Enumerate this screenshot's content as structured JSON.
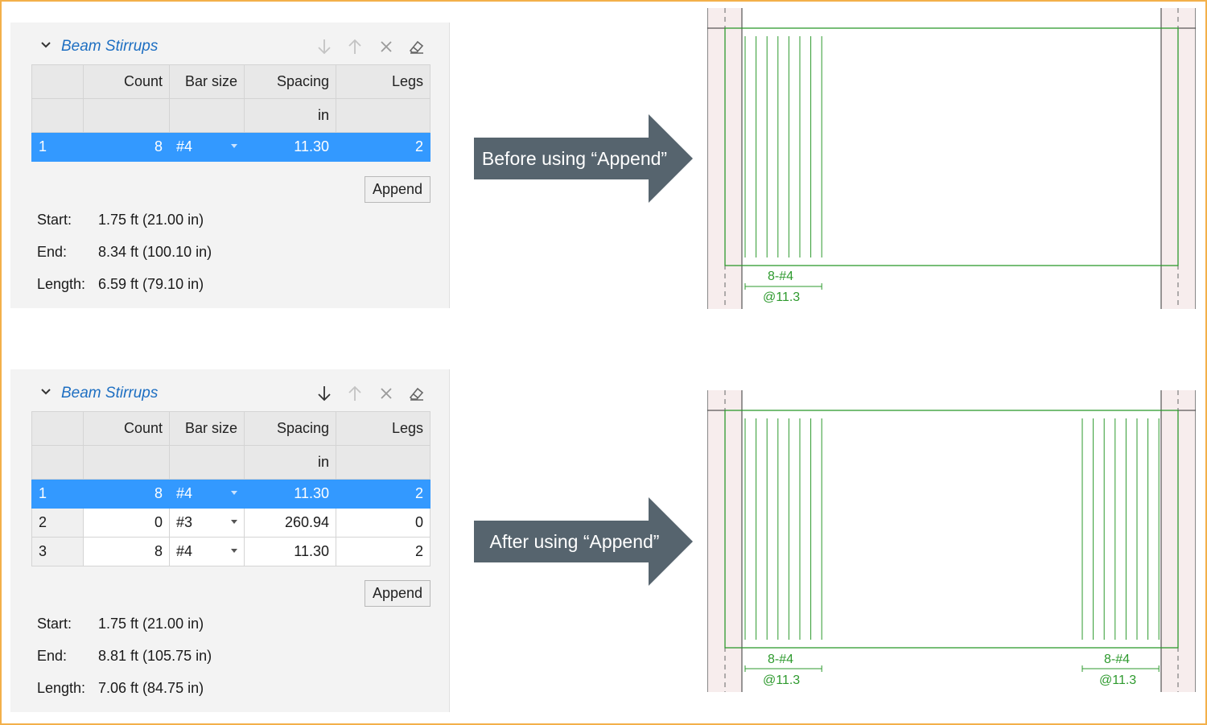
{
  "panels": [
    {
      "title": "Beam Stirrups",
      "icons": [
        "collapse-chevron-icon",
        "move-down-icon",
        "move-up-icon",
        "delete-icon",
        "eraser-icon"
      ],
      "columns": [
        "",
        "Count",
        "Bar size",
        "Spacing",
        "Legs"
      ],
      "units": [
        "",
        "",
        "",
        "in",
        ""
      ],
      "rows": [
        {
          "index": "1",
          "count": "8",
          "bar_size": "#4",
          "spacing": "11.30",
          "legs": "2",
          "selected": true
        }
      ],
      "append_label": "Append",
      "info": [
        {
          "label": "Start:",
          "value": "1.75 ft (21.00 in)"
        },
        {
          "label": "End:",
          "value": "8.34 ft (100.10 in)"
        },
        {
          "label": "Length:",
          "value": "6.59 ft (79.10 in)"
        }
      ]
    },
    {
      "title": "Beam Stirrups",
      "icons": [
        "collapse-chevron-icon",
        "move-down-icon",
        "move-up-icon",
        "delete-icon",
        "eraser-icon"
      ],
      "columns": [
        "",
        "Count",
        "Bar size",
        "Spacing",
        "Legs"
      ],
      "units": [
        "",
        "",
        "",
        "in",
        ""
      ],
      "rows": [
        {
          "index": "1",
          "count": "8",
          "bar_size": "#4",
          "spacing": "11.30",
          "legs": "2",
          "selected": true
        },
        {
          "index": "2",
          "count": "0",
          "bar_size": "#3",
          "spacing": "260.94",
          "legs": "0",
          "selected": false
        },
        {
          "index": "3",
          "count": "8",
          "bar_size": "#4",
          "spacing": "11.30",
          "legs": "2",
          "selected": false
        }
      ],
      "append_label": "Append",
      "info": [
        {
          "label": "Start:",
          "value": "1.75 ft (21.00 in)"
        },
        {
          "label": "End:",
          "value": "8.81 ft (105.75 in)"
        },
        {
          "label": "Length:",
          "value": "7.06 ft (84.75 in)"
        }
      ]
    }
  ],
  "callouts": [
    {
      "text": "Before using “Append”"
    },
    {
      "text": "After using “Append”"
    }
  ],
  "drawings": [
    {
      "groups": [
        {
          "label": "8-#4",
          "spacing_label": "@11.3",
          "side": "left",
          "count": 8
        }
      ]
    },
    {
      "groups": [
        {
          "label": "8-#4",
          "spacing_label": "@11.3",
          "side": "left",
          "count": 8
        },
        {
          "label": "8-#4",
          "spacing_label": "@11.3",
          "side": "right",
          "count": 8
        }
      ]
    }
  ],
  "colors": {
    "frame": "#f3b04a",
    "title": "#1e6fc2",
    "selection": "#3399ff",
    "callout": "#56646e",
    "stirrup": "#2e9a2e",
    "support_fill": "#f7eded"
  }
}
